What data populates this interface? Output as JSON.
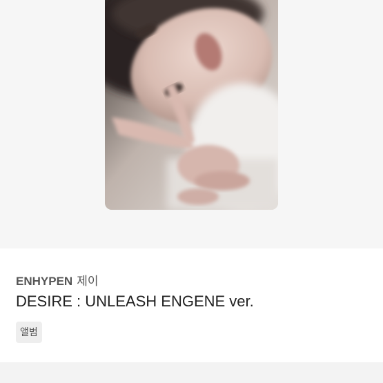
{
  "product": {
    "artist": "ENHYPEN",
    "member": "제이",
    "title": "DESIRE : UNLEASH ENGENE ver.",
    "tag": "앨범"
  }
}
